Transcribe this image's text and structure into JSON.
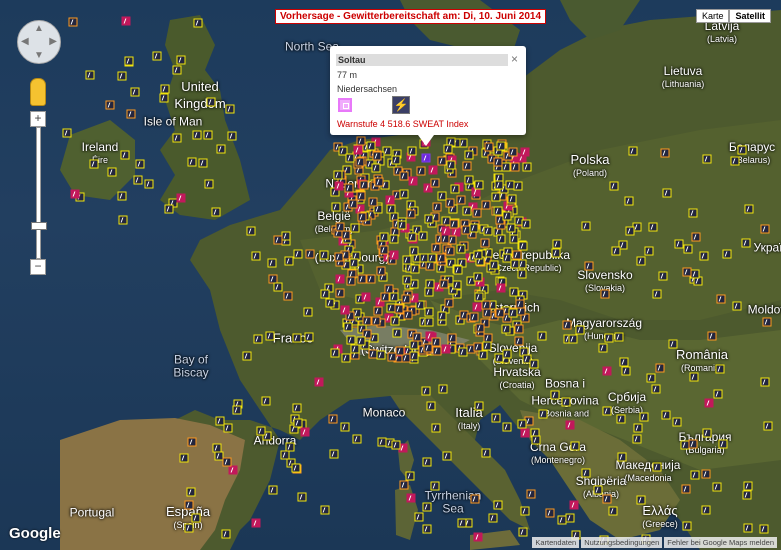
{
  "title": "Vorhersage - Gewitterbereitschaft am: Di, 10. Juni 2014",
  "map_type": {
    "map": "Karte",
    "satellite": "Satellit",
    "selected": "satellite"
  },
  "controls": {
    "zoom_in": "+",
    "zoom_out": "−",
    "pan": "pan-control",
    "streetview": "pegman-icon"
  },
  "popup": {
    "title": "Soltau",
    "elevation": "77 m",
    "region": "Niedersachsen",
    "close": "×",
    "warning": "Warnstufe 4   518.6  SWEAT Index"
  },
  "attribution": {
    "logo": "Google",
    "links": [
      "Kartendaten",
      "Nutzungsbedingungen",
      "Fehler bei Google Maps melden"
    ]
  },
  "colors": {
    "level_low": "#f3e60c",
    "level_mid": "#ff9a1f",
    "level_high": "#c2185b",
    "level_max": "#6d28d9"
  },
  "labels": {
    "north_sea": "North Sea",
    "uk": {
      "name": "United",
      "name2": "Kingdom"
    },
    "isle_of_man": "Isle of Man",
    "ireland": {
      "name": "Ireland",
      "sub": "Éire"
    },
    "netherlands": "Nederland",
    "belgium": {
      "name": "België",
      "sub": "(Belgium)"
    },
    "lux": "(Luxembourg)",
    "france": "France",
    "bay_biscay": {
      "name": "Bay of",
      "name2": "Biscay"
    },
    "spain": {
      "name": "España",
      "sub": "(Spain)"
    },
    "portugal": "Portugal",
    "monaco": "Monaco",
    "andorra": "Andorra",
    "switzerland": "(Switzerland)",
    "italy": {
      "name": "Italia",
      "sub": "(Italy)"
    },
    "tyrrhenian": {
      "name": "Tyrrhenian",
      "name2": "Sea"
    },
    "poland": {
      "name": "Polska",
      "sub": "(Poland)"
    },
    "czech": {
      "name": "Česká republika",
      "sub": "(Czech Republic)"
    },
    "slovakia": {
      "name": "Slovensko",
      "sub": "(Slovakia)"
    },
    "austria": "Österreich",
    "hungary": {
      "name": "Magyarország",
      "sub": "(Hungary)"
    },
    "slovenia": {
      "name": "Slovenija",
      "sub": "(Slovenia)"
    },
    "croatia": {
      "name": "Hrvatska",
      "sub": "(Croatia)"
    },
    "bosnia": {
      "name": "Bosna i",
      "name2": "Hercegovina",
      "sub": "(Bosnia and"
    },
    "serbia": {
      "name": "Србија",
      "sub": "(Serbia)"
    },
    "montenegro": {
      "name": "Crna Gora",
      "sub": "(Montenegro)"
    },
    "macedonia": {
      "name": "Македонија",
      "sub": "(Macedonia"
    },
    "albania": {
      "name": "Shqipëria",
      "sub": "(Albania)"
    },
    "greece": {
      "name": "Ελλάς",
      "sub": "(Greece)"
    },
    "romania": {
      "name": "România",
      "sub": "(Romania)"
    },
    "bulgaria": {
      "name": "България",
      "sub": "(Bulgaria)"
    },
    "moldova": "Moldov",
    "lithuania": {
      "name": "Lietuva",
      "sub": "(Lithuania)"
    },
    "latvia": {
      "name": "Latvija",
      "sub": "(Latvia)"
    },
    "belarus": {
      "name": "Беларус",
      "sub": "(Belarus)"
    },
    "ukraine": "Украї"
  }
}
